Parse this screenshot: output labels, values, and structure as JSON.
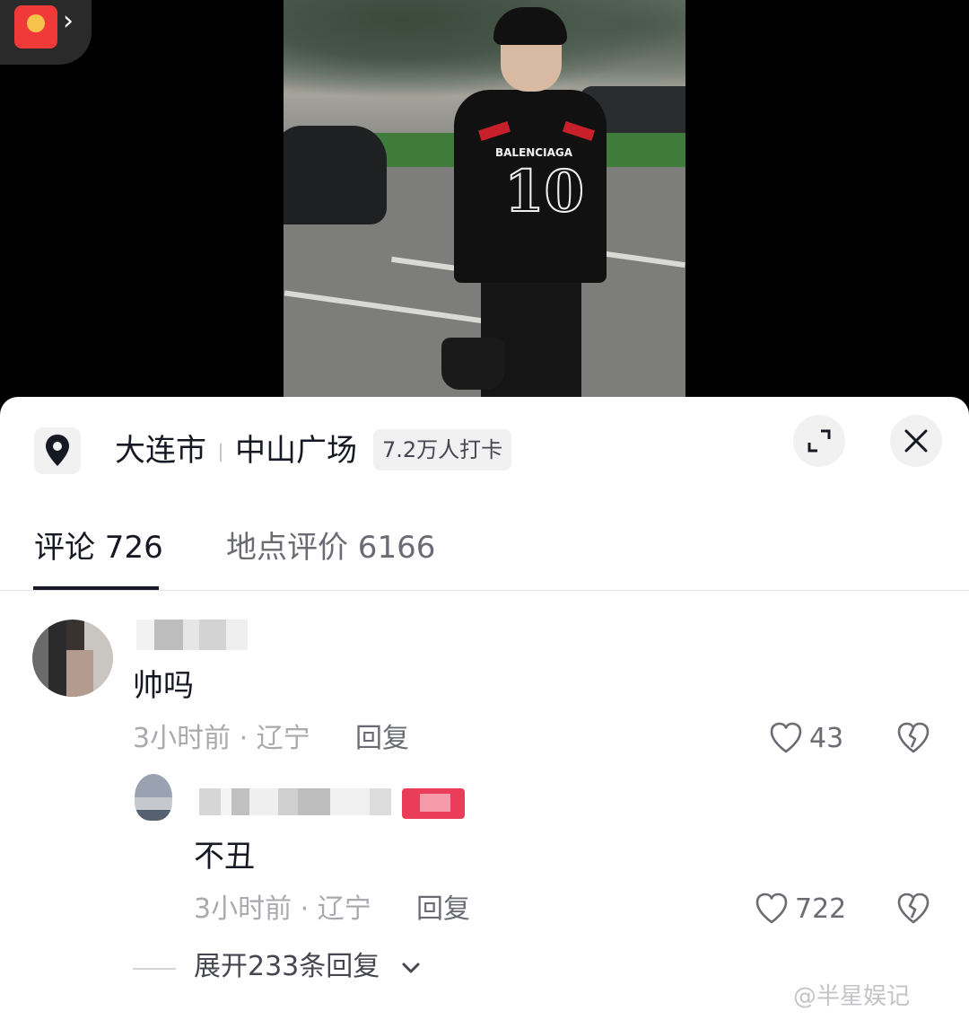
{
  "location": {
    "city": "大连市",
    "place": "中山广场",
    "checkins": "7.2万人打卡"
  },
  "tabs": [
    {
      "label": "评论 726",
      "active": true
    },
    {
      "label": "地点评价 6166",
      "active": false
    }
  ],
  "comments": [
    {
      "text": "帅吗",
      "meta": "3小时前 · 辽宁",
      "reply_label": "回复",
      "likes": "43"
    }
  ],
  "reply": {
    "text": "不丑",
    "meta": "3小时前 · 辽宁",
    "reply_label": "回复",
    "likes": "722"
  },
  "expand": {
    "label": "展开233条回复"
  },
  "video": {
    "brand": "BALENCIAGA",
    "number": "10"
  },
  "watermark": "@半星娱记",
  "colors": {
    "text_primary": "#161823",
    "text_secondary": "#6b6c73",
    "text_muted": "#a9a9ae",
    "red_packet": "#f03a3a"
  },
  "icons": [
    "location-pin-icon",
    "expand-icon",
    "close-icon",
    "heart-icon",
    "broken-heart-icon",
    "chevron-down-icon",
    "red-packet-icon"
  ]
}
